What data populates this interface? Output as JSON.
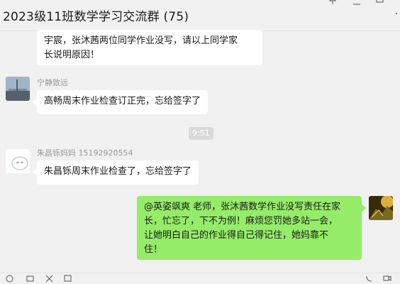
{
  "window": {
    "title": "2023级11班数学学习交流群 (75)"
  },
  "messages": [
    {
      "sender": "",
      "text_line1": "宇宸，张沐茜两位同学作业没写，请以上同学家",
      "text_line2": "长说明原因！"
    },
    {
      "sender": "宁静致远",
      "text": "高畅周末作业检查订正完，忘给签字了"
    },
    {
      "timestamp": "9:51"
    },
    {
      "sender": "朱昌铄妈妈 15192920554",
      "text": "朱昌铄周末作业检查了，忘给签字了"
    },
    {
      "sender": "me",
      "text_line1": "@英姿飒爽 老师，张沐茜数学作业没写责任在家",
      "text_line2": "长，忙忘了，下不为例！麻烦您罚她多站一会，",
      "text_line3": "让她明白自己的作业得自己得记住，她妈靠不",
      "text_line4": "住！"
    }
  ],
  "icons": [
    "pin-icon",
    "minimize-icon",
    "maximize-icon",
    "more-icon",
    "emoji-icon",
    "folder-icon",
    "scissors-icon",
    "chat-history-icon",
    "voice-call-icon",
    "video-call-icon"
  ],
  "colors": {
    "background": "#f1f1f1",
    "bubble_in": "#ffffff",
    "bubble_out": "#95ec69",
    "name_gray": "#9a9a9a"
  }
}
